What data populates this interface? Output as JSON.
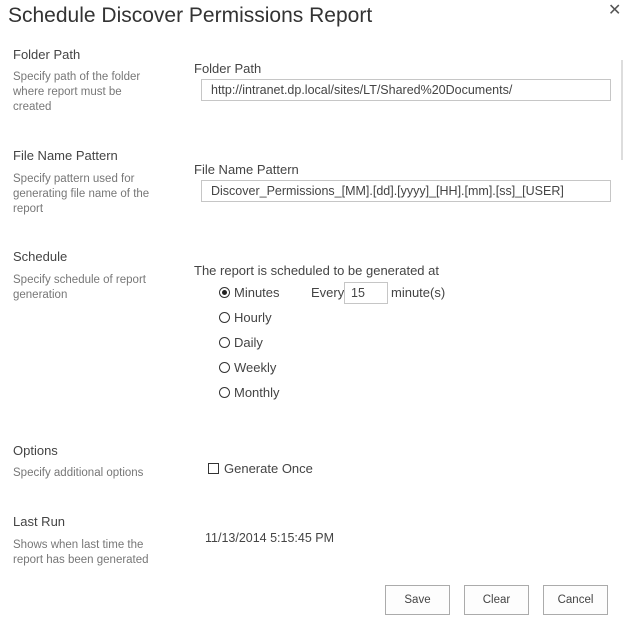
{
  "dialog": {
    "title": "Schedule Discover Permissions Report",
    "close_icon": "close-icon"
  },
  "folder": {
    "heading": "Folder Path",
    "description": "Specify path of the folder where report must be created",
    "label": "Folder Path",
    "value": "http://intranet.dp.local/sites/LT/Shared%20Documents/"
  },
  "filename": {
    "heading": "File Name Pattern",
    "description": "Specify pattern used for generating file name of the report",
    "label": "File Name Pattern",
    "value": "Discover_Permissions_[MM].[dd].[yyyy]_[HH].[mm].[ss]_[USER]"
  },
  "schedule": {
    "heading": "Schedule",
    "description": "Specify schedule of report generation",
    "label": "The report is scheduled to be generated at",
    "options": [
      {
        "label": "Minutes",
        "selected": true
      },
      {
        "label": "Hourly",
        "selected": false
      },
      {
        "label": "Daily",
        "selected": false
      },
      {
        "label": "Weekly",
        "selected": false
      },
      {
        "label": "Monthly",
        "selected": false
      }
    ],
    "every_label": "Every",
    "every_value": "15",
    "unit_label": "minute(s)"
  },
  "options": {
    "heading": "Options",
    "description": "Specify additional options",
    "generate_once_label": "Generate Once",
    "generate_once_checked": false
  },
  "last_run": {
    "heading": "Last Run",
    "description": "Shows when last time the report has been generated",
    "value": "11/13/2014 5:15:45 PM"
  },
  "buttons": {
    "save": "Save",
    "clear": "Clear",
    "cancel": "Cancel"
  }
}
